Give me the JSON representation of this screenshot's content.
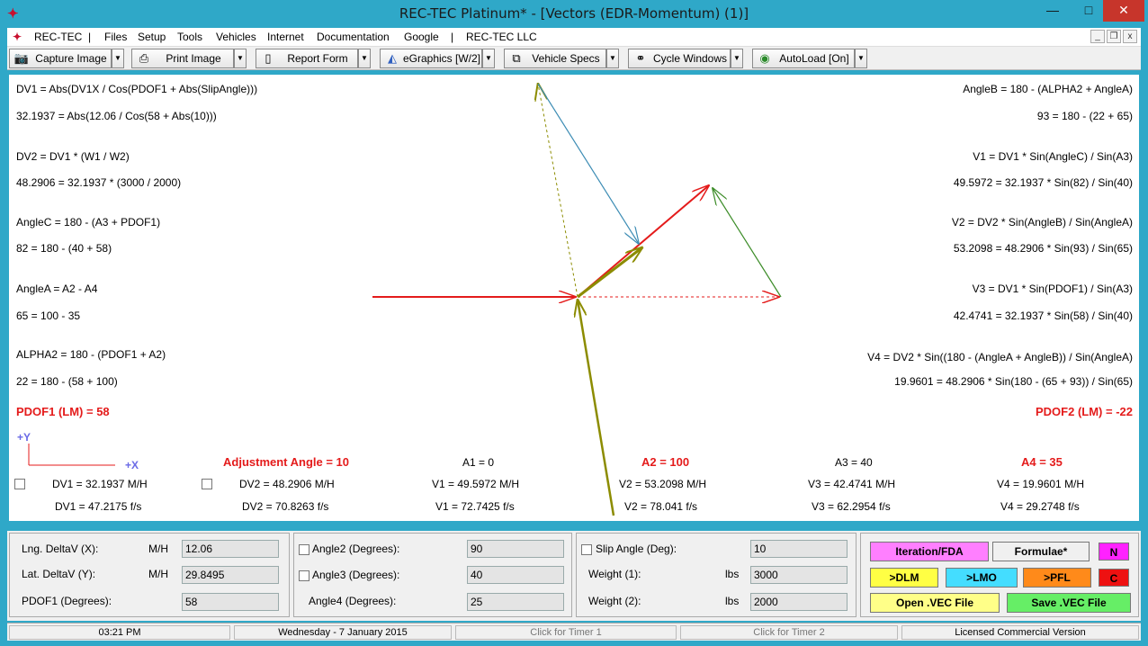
{
  "window": {
    "title": "REC-TEC Platinum* - [Vectors (EDR-Momentum) (1)]",
    "minimize": "—",
    "maximize": "□",
    "close": "✕",
    "app_icon": "rec-tec-logo-icon"
  },
  "menu": {
    "logo": "REC-TEC",
    "items": [
      "|",
      "Files",
      "Setup",
      "Tools",
      "Vehicles",
      "Internet",
      "Documentation",
      "Google",
      "|",
      "REC-TEC LLC"
    ],
    "mdi_minimize": "_",
    "mdi_restore": "❐",
    "mdi_close": "x"
  },
  "toolbar": {
    "buttons": [
      {
        "label": "Capture Image",
        "icon": "camera-icon"
      },
      {
        "label": "Print Image",
        "icon": "printer-icon"
      },
      {
        "label": "Report Form",
        "icon": "document-icon"
      },
      {
        "label": "eGraphics [W/2]",
        "icon": "graphics-icon"
      },
      {
        "label": "Vehicle Specs",
        "icon": "copy-icon"
      },
      {
        "label": "Cycle Windows",
        "icon": "binoculars-icon"
      },
      {
        "label": "AutoLoad [On]",
        "icon": "disc-icon"
      }
    ],
    "dropdown_glyph": "▼"
  },
  "formulas_left": [
    "DV1 = Abs(DV1X / Cos(PDOF1 + Abs(SlipAngle)))",
    "32.1937 = Abs(12.06 / Cos(58 + Abs(10)))",
    "DV2 = DV1 * (W1 / W2)",
    "48.2906 = 32.1937 * (3000 / 2000)",
    "AngleC = 180 - (A3 + PDOF1)",
    "82 = 180 - (40 + 58)",
    "AngleA = A2 - A4",
    "65 = 100 - 35",
    "ALPHA2 = 180 - (PDOF1 + A2)",
    "22 = 180 - (58 + 100)"
  ],
  "formulas_right": [
    "AngleB = 180 - (ALPHA2 + AngleA)",
    "93 = 180 - (22 + 65)",
    "V1 = DV1 * Sin(AngleC) / Sin(A3)",
    "49.5972 = 32.1937 * Sin(82) / Sin(40)",
    "V2 = DV2 * Sin(AngleB) / Sin(AngleA)",
    "53.2098 = 48.2906 * Sin(93) / Sin(65)",
    "V3 = DV1 * Sin(PDOF1) / Sin(A3)",
    "42.4741 = 32.1937 * Sin(58) / Sin(40)",
    "V4 = DV2 * Sin((180 - (AngleA + AngleB)) / Sin(AngleA)",
    "19.9601 = 48.2906 * Sin(180 - (65 + 93)) / Sin(65)"
  ],
  "pdof1": "PDOF1 (LM) = 58",
  "pdof2": "PDOF2 (LM) = -22",
  "axis": {
    "y": "+Y",
    "x": "+X"
  },
  "angles_row": {
    "adjustment": "Adjustment Angle = 10",
    "a1": "A1 = 0",
    "a2": "A2 = 100",
    "a3": "A3 = 40",
    "a4": "A4 = 35"
  },
  "results_mph": {
    "dv1": "DV1 = 32.1937  M/H",
    "dv2": "DV2 = 48.2906  M/H",
    "v1": "V1 = 49.5972  M/H",
    "v2": "V2 = 53.2098  M/H",
    "v3": "V3 = 42.4741  M/H",
    "v4": "V4 = 19.9601  M/H"
  },
  "results_fps": {
    "dv1": "DV1 = 47.2175  f/s",
    "dv2": "DV2 = 70.8263  f/s",
    "v1": "V1 = 72.7425  f/s",
    "v2": "V2 = 78.041  f/s",
    "v3": "V3 = 62.2954  f/s",
    "v4": "V4 = 29.2748  f/s"
  },
  "inputs_left": {
    "lng_label": "Lng. DeltaV (X):",
    "lng_unit": "M/H",
    "lng_value": "12.06",
    "lat_label": "Lat. DeltaV (Y):",
    "lat_unit": "M/H",
    "lat_value": "29.8495",
    "pdof_label": "PDOF1 (Degrees):",
    "pdof_value": "58"
  },
  "inputs_mid": {
    "angle2_label": "Angle2 (Degrees):",
    "angle2_value": "90",
    "angle3_label": "Angle3 (Degrees):",
    "angle3_value": "40",
    "angle4_label": "Angle4 (Degrees):",
    "angle4_value": "25"
  },
  "inputs_right": {
    "slip_label": "Slip Angle (Deg):",
    "slip_value": "10",
    "w1_label": "Weight (1):",
    "w1_unit": "lbs",
    "w1_value": "3000",
    "w2_label": "Weight (2):",
    "w2_unit": "lbs",
    "w2_value": "2000"
  },
  "command_buttons": {
    "iteration": "Iteration/FDA",
    "formulae": "Formulae*",
    "n": "N",
    "dlm": ">DLM",
    "lmo": ">LMO",
    "pfl": ">PFL",
    "c": "C",
    "open": "Open  .VEC File",
    "save": "Save  .VEC File"
  },
  "status": {
    "time": "03:21 PM",
    "date": "Wednesday  -  7 January 2015",
    "timer1": "Click for Timer 1",
    "timer2": "Click for Timer 2",
    "license": "Licensed Commercial Version"
  },
  "colors": {
    "title_bg": "#2fa8c8",
    "red_vector": "#e41b1b",
    "olive_vector": "#8c8c00",
    "green_vector": "#3c8c28",
    "blue_vector": "#3c8cb4",
    "btn_magenta": "#ff7fff",
    "btn_yellow": "#ffff44",
    "btn_cyan": "#44ddff",
    "btn_orange": "#ff8a1a",
    "btn_red": "#ee1111",
    "btn_green": "#66ee66"
  }
}
